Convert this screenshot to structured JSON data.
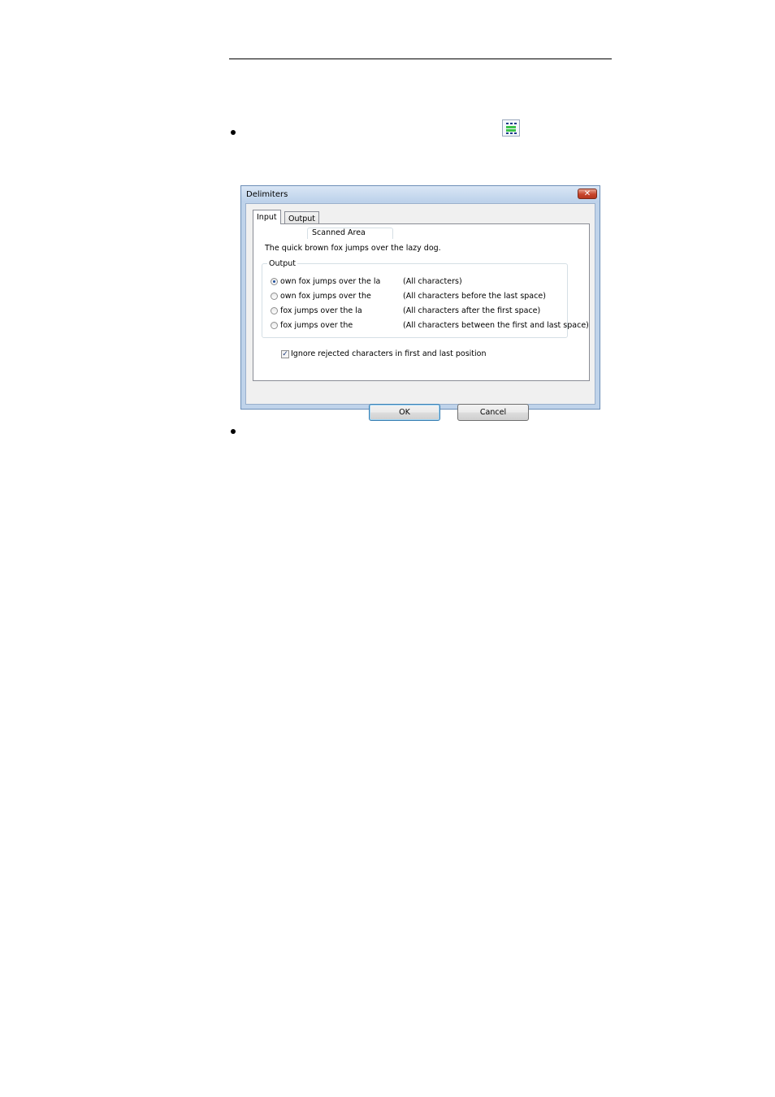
{
  "page": {
    "toolbar_icon": "delimiters-grid-icon"
  },
  "dialog": {
    "title": "Delimiters",
    "close_icon": "close-icon",
    "tabs": [
      {
        "label": "Input",
        "active": true
      },
      {
        "label": "Output",
        "active": false
      }
    ],
    "scanned_area_label": "Scanned Area",
    "sample_text": "The quick brown fox jumps over the lazy dog.",
    "output_group_label": "Output",
    "options": [
      {
        "label": "own fox jumps over the la",
        "description": "(All characters)",
        "selected": true
      },
      {
        "label": "own fox jumps over the",
        "description": "(All characters before the last space)",
        "selected": false
      },
      {
        "label": "fox jumps over the la",
        "description": "(All characters after the first space)",
        "selected": false
      },
      {
        "label": "fox jumps over the",
        "description": "(All characters between the first and last space)",
        "selected": false
      }
    ],
    "ignore_checkbox": {
      "label": "Ignore rejected characters in first and last position",
      "checked": true
    },
    "ok_label": "OK",
    "cancel_label": "Cancel"
  }
}
